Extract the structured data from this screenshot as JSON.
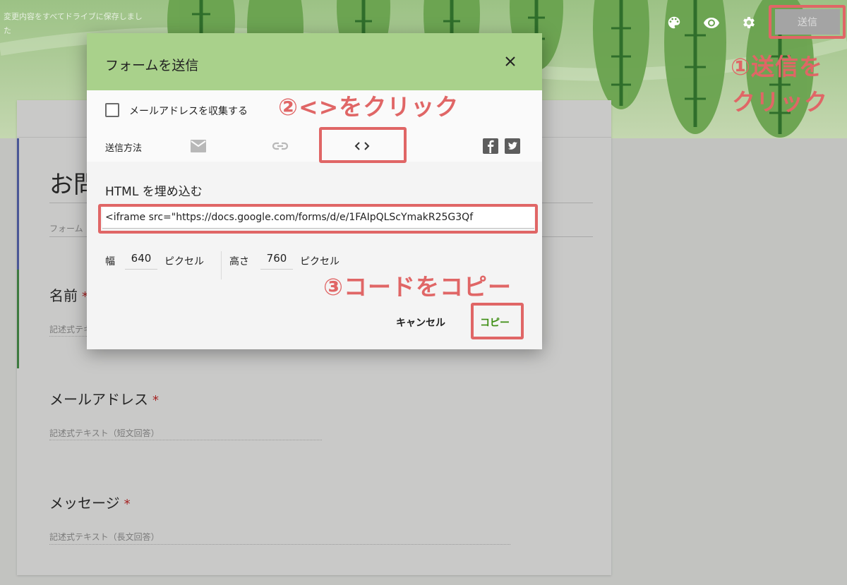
{
  "header": {
    "save_status": "変更内容をすべてドライブに保存しました",
    "icons": [
      "palette-icon",
      "eye-icon",
      "gear-icon"
    ],
    "send_label": "送信"
  },
  "form": {
    "title": "お問",
    "description": "フォーム",
    "questions": [
      {
        "label": "名前",
        "required": "*",
        "hint": "記述式テキ"
      },
      {
        "label": "メールアドレス",
        "required": "*",
        "hint": "記述式テキスト（短文回答）"
      },
      {
        "label": "メッセージ",
        "required": "*",
        "hint": "記述式テキスト（長文回答）"
      }
    ]
  },
  "dialog": {
    "title": "フォームを送信",
    "collect_email_label": "メールアドレスを収集する",
    "send_method_label": "送信方法",
    "method_icons": [
      "mail-icon",
      "link-icon",
      "code-icon",
      "facebook-icon",
      "twitter-icon"
    ],
    "embed_heading": "HTML を埋め込む",
    "embed_code": "<iframe src=\"https://docs.google.com/forms/d/e/1FAIpQLScYmakR25G3Qf",
    "width_label": "幅",
    "width_value": "640",
    "width_unit": "ピクセル",
    "height_label": "高さ",
    "height_value": "760",
    "height_unit": "ピクセル",
    "cancel_label": "キャンセル",
    "copy_label": "コピー"
  },
  "annotations": {
    "step1_line1": "①送信を",
    "step1_line2": "クリック",
    "step2": "②<>をクリック",
    "step3": "③コードをコピー"
  },
  "colors": {
    "dialog_header": "#a9d18b",
    "annotation": "#e06666",
    "copy_button": "#3e8e14",
    "accent_blue": "#3f51b5",
    "accent_green": "#2e7d32"
  }
}
